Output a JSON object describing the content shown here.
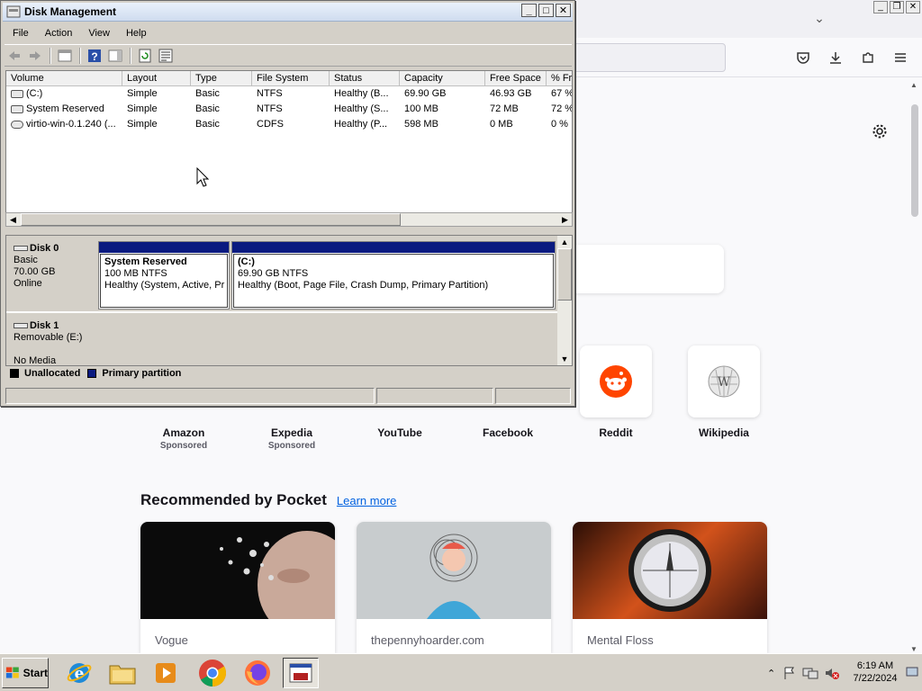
{
  "firefox": {
    "shortcuts": [
      {
        "name": "Amazon",
        "sponsored": "Sponsored"
      },
      {
        "name": "Expedia",
        "sponsored": "Sponsored"
      },
      {
        "name": "YouTube",
        "sponsored": ""
      },
      {
        "name": "Facebook",
        "sponsored": ""
      },
      {
        "name": "Reddit",
        "sponsored": ""
      },
      {
        "name": "Wikipedia",
        "sponsored": ""
      }
    ],
    "pocket": {
      "title": "Recommended by Pocket",
      "learn_more": "Learn more",
      "cards": [
        {
          "source": "Vogue"
        },
        {
          "source": "thepennyhoarder.com"
        },
        {
          "source": "Mental Floss"
        }
      ]
    }
  },
  "dm": {
    "title": "Disk Management",
    "menu": [
      "File",
      "Action",
      "View",
      "Help"
    ],
    "columns": [
      "Volume",
      "Layout",
      "Type",
      "File System",
      "Status",
      "Capacity",
      "Free Space",
      "% Fr"
    ],
    "volumes": [
      [
        "(C:)",
        "Simple",
        "Basic",
        "NTFS",
        "Healthy (B...",
        "69.90 GB",
        "46.93 GB",
        "67 %"
      ],
      [
        "System Reserved",
        "Simple",
        "Basic",
        "NTFS",
        "Healthy (S...",
        "100 MB",
        "72 MB",
        "72 %"
      ],
      [
        "virtio-win-0.1.240 (...",
        "Simple",
        "Basic",
        "CDFS",
        "Healthy (P...",
        "598 MB",
        "0 MB",
        "0 %"
      ]
    ],
    "disk0": {
      "name": "Disk 0",
      "type": "Basic",
      "size": "70.00 GB",
      "state": "Online",
      "partitions": [
        {
          "name": "System Reserved",
          "size": "100 MB NTFS",
          "status": "Healthy (System, Active, Pr"
        },
        {
          "name": "(C:)",
          "size": "69.90 GB NTFS",
          "status": "Healthy (Boot, Page File, Crash Dump, Primary Partition)"
        }
      ]
    },
    "disk1": {
      "name": "Disk 1",
      "type": "Removable (E:)",
      "media": "No Media"
    },
    "legend": {
      "unallocated": "Unallocated",
      "primary": "Primary partition"
    },
    "colors": {
      "partition_bar": "#0a1a80",
      "unallocated": "#000000"
    }
  },
  "taskbar": {
    "start": "Start",
    "time": "6:19 AM",
    "date": "7/22/2024"
  }
}
